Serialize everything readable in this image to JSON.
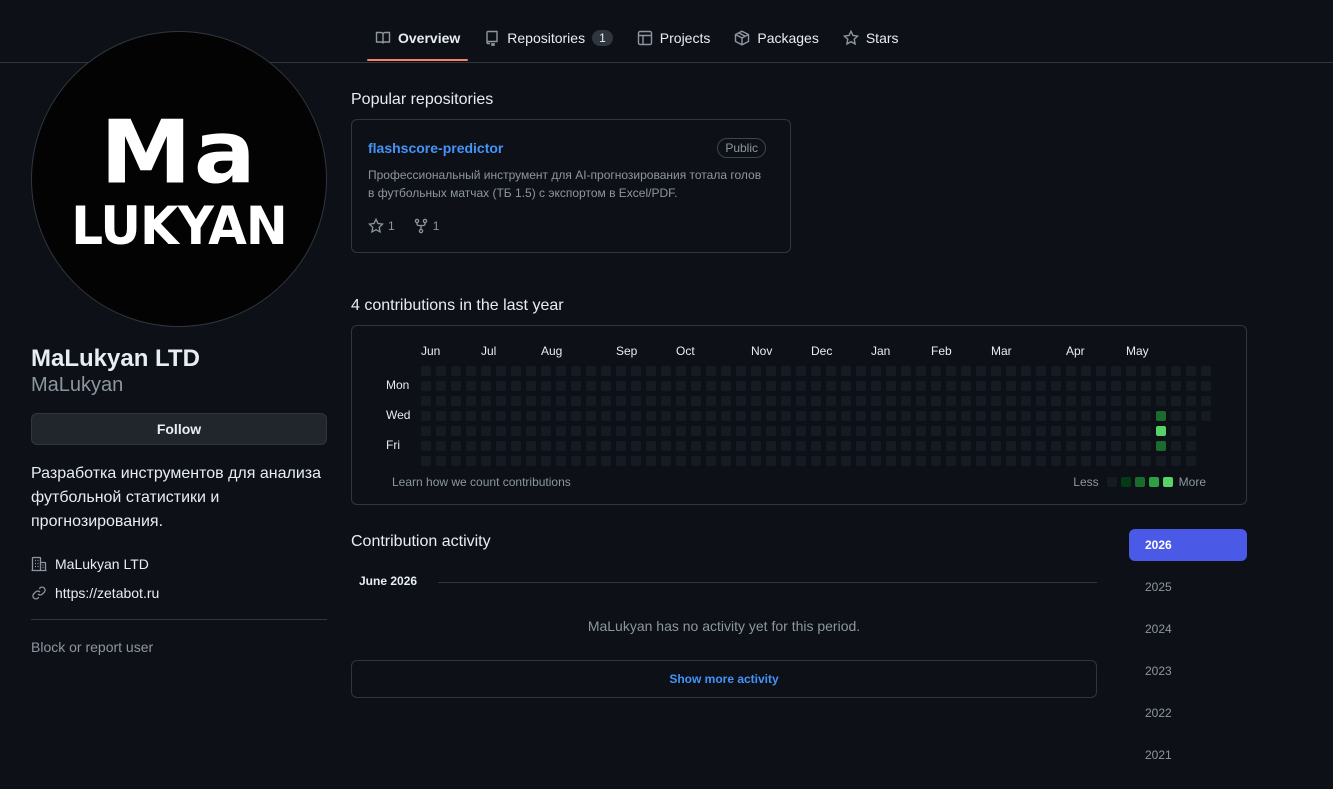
{
  "nav": {
    "tabs": [
      {
        "label": "Overview",
        "icon": "book-icon"
      },
      {
        "label": "Repositories",
        "icon": "repo-icon",
        "count": "1"
      },
      {
        "label": "Projects",
        "icon": "table-icon"
      },
      {
        "label": "Packages",
        "icon": "package-icon"
      },
      {
        "label": "Stars",
        "icon": "star-icon"
      }
    ]
  },
  "profile": {
    "avatar_line1": "Ma",
    "avatar_line2": "LUKYAN",
    "full_name": "MaLukyan LTD",
    "username": "MaLukyan",
    "follow_label": "Follow",
    "bio": "Разработка инструментов для анализа футбольной статистики и прогнозирования.",
    "company": "MaLukyan LTD",
    "website": "https://zetabot.ru",
    "block_label": "Block or report user"
  },
  "popular": {
    "heading": "Popular repositories",
    "repos": [
      {
        "name": "flashscore-predictor",
        "visibility": "Public",
        "description": "Профессиональный инструмент для AI-прогнозирования тотала голов в футбольных матчах (ТБ 1.5) с экспортом в Excel/PDF.",
        "stars": "1",
        "forks": "1"
      }
    ]
  },
  "contributions": {
    "heading": "4 contributions in the last year",
    "months": [
      "Jun",
      "Jul",
      "Aug",
      "Sep",
      "Oct",
      "Nov",
      "Dec",
      "Jan",
      "Feb",
      "Mar",
      "Apr",
      "May"
    ],
    "day_labels": [
      "Mon",
      "Wed",
      "Fri"
    ],
    "learn_link": "Learn how we count contributions",
    "legend_less": "Less",
    "legend_more": "More",
    "levels": [
      "#151b23",
      "#033a16",
      "#196c2e",
      "#2ea043",
      "#56d364"
    ],
    "active_cells": [
      {
        "week": 49,
        "day": 3,
        "level": 2
      },
      {
        "week": 49,
        "day": 4,
        "level": 4
      },
      {
        "week": 49,
        "day": 5,
        "level": 2
      }
    ]
  },
  "activity": {
    "heading": "Contribution activity",
    "month": "June 2026",
    "empty_text": "MaLukyan has no activity yet for this period.",
    "show_more": "Show more activity",
    "years": [
      "2026",
      "2025",
      "2024",
      "2023",
      "2022",
      "2021"
    ],
    "selected_year": "2026"
  }
}
